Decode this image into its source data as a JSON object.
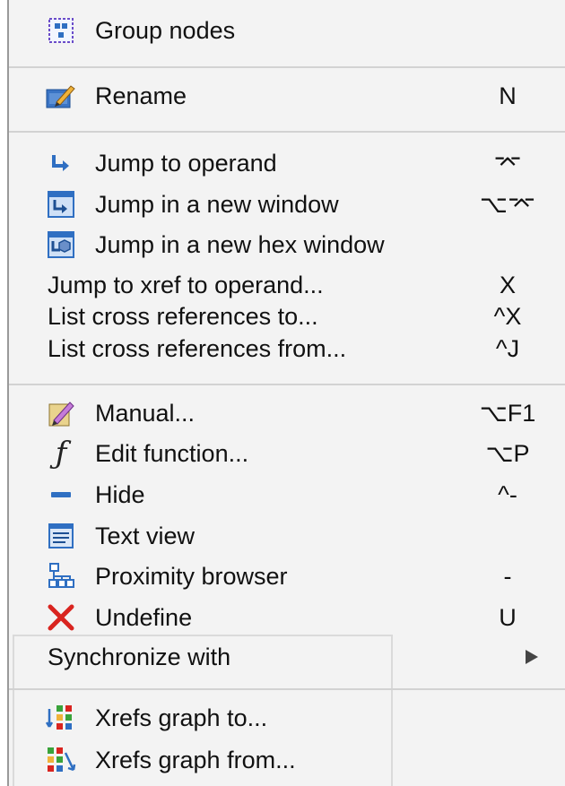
{
  "menu": {
    "items": [
      {
        "label": "Group nodes",
        "shortcut": "",
        "icon": "group-nodes-icon"
      },
      {
        "label": "Rename",
        "shortcut": "N",
        "icon": "rename-icon"
      },
      {
        "label": "Jump to operand",
        "shortcut": "⌤",
        "icon": "jump-arrow-icon"
      },
      {
        "label": "Jump in a new window",
        "shortcut": "⌥⌤",
        "icon": "jump-window-icon"
      },
      {
        "label": "Jump in a new hex window",
        "shortcut": "",
        "icon": "hex-window-icon"
      },
      {
        "label": "Jump to xref to operand...",
        "shortcut": "X"
      },
      {
        "label": "List cross references to...",
        "shortcut": "^X"
      },
      {
        "label": "List cross references from...",
        "shortcut": "^J"
      },
      {
        "label": "Manual...",
        "shortcut": "⌥F1",
        "icon": "pencil-ruler-icon"
      },
      {
        "label": "Edit function...",
        "shortcut": "⌥P",
        "icon": "function-icon"
      },
      {
        "label": "Hide",
        "shortcut": "^-",
        "icon": "minus-icon"
      },
      {
        "label": "Text view",
        "shortcut": "",
        "icon": "text-view-icon"
      },
      {
        "label": "Proximity browser",
        "shortcut": "-",
        "icon": "hierarchy-icon"
      },
      {
        "label": "Undefine",
        "shortcut": "U",
        "icon": "red-x-icon"
      },
      {
        "label": "Synchronize with",
        "shortcut": ""
      },
      {
        "label": "Xrefs graph to...",
        "shortcut": "",
        "icon": "xrefs-to-icon"
      },
      {
        "label": "Xrefs graph from...",
        "shortcut": "",
        "icon": "xrefs-from-icon"
      }
    ]
  },
  "colors": {
    "menu_bg": "#f3f3f3",
    "separator": "#d2d2d2",
    "icon_blue": "#2f6fc2",
    "undefine_red": "#d9241f"
  }
}
